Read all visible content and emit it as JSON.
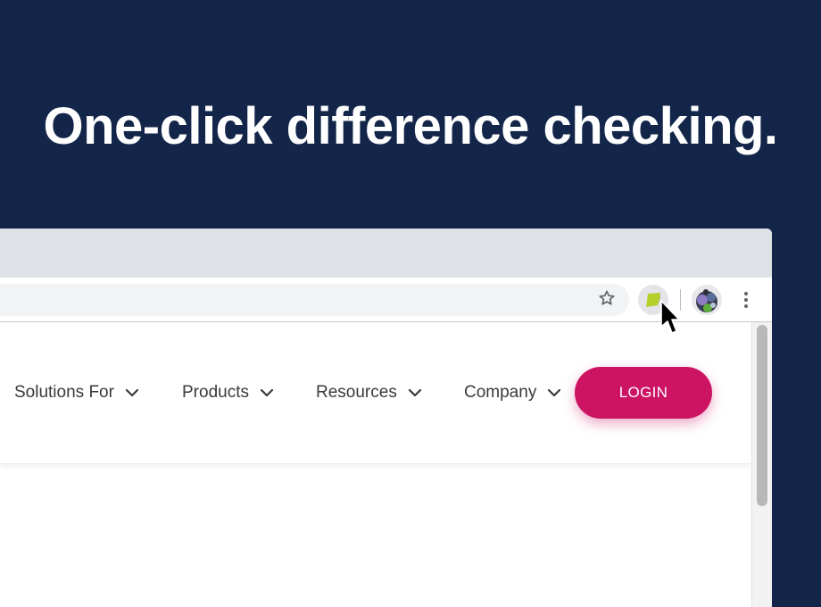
{
  "headline": "One-click difference checking.",
  "browser": {
    "toolbar": {
      "bookmark_icon": "star-outline-icon",
      "extension_icon": "draftable-extension-icon",
      "profile_icon": "avatar",
      "menu_icon": "vertical-dots-icon"
    },
    "colors": {
      "background": "#13264a",
      "tabstrip": "#dee1e6",
      "extension_green": "#b5d02a"
    }
  },
  "site": {
    "nav": [
      {
        "label": "Solutions For"
      },
      {
        "label": "Products"
      },
      {
        "label": "Resources"
      },
      {
        "label": "Company"
      }
    ],
    "login_label": "LOGIN",
    "accent": "#cc1463"
  }
}
